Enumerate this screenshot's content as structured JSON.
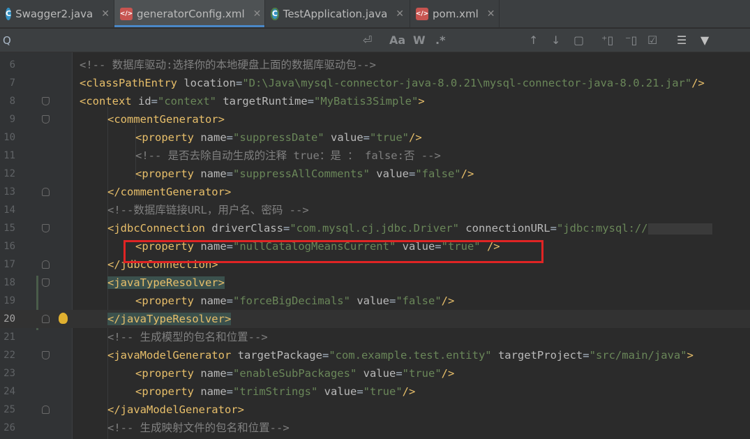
{
  "tabs": [
    {
      "label": "Swagger2.java",
      "icon": "java-class-icon",
      "active": false
    },
    {
      "label": "generatorConfig.xml",
      "icon": "xml-file-icon",
      "active": true
    },
    {
      "label": "TestApplication.java",
      "icon": "spring-app-icon",
      "active": false
    },
    {
      "label": "pom.xml",
      "icon": "xml-file-icon",
      "active": false
    }
  ],
  "tab_close_glyph": "✕",
  "toolbar": {
    "search_glyph": "Q",
    "regex_wrap_glyph": "⏎",
    "match_case": "Aa",
    "words": "W",
    "regex": ".*",
    "prev_glyph": "↑",
    "next_glyph": "↓",
    "select_all_glyph": "▢",
    "add_sel_glyph": "⁺▯",
    "remove_sel_glyph": "⁻▯",
    "toggle_sel_glyph": "☑",
    "filter_glyph": "▼",
    "settings_glyph": "☰"
  },
  "lines": [
    {
      "n": "6",
      "parts": [
        [
          "c",
          "<!-- 数据库驱动:选择你的本地硬盘上面的数据库驱动包-->"
        ]
      ]
    },
    {
      "n": "7",
      "parts": [
        [
          "t",
          "<classPathEntry "
        ],
        [
          "a",
          "location"
        ],
        [
          "p",
          "="
        ],
        [
          "v",
          "\"D:\\Java\\mysql-connector-java-8.0.21\\mysql-connector-java-8.0.21.jar\""
        ],
        [
          "t",
          "/>"
        ]
      ]
    },
    {
      "n": "8",
      "parts": [
        [
          "t",
          "<context "
        ],
        [
          "a",
          "id"
        ],
        [
          "p",
          "="
        ],
        [
          "v",
          "\"context\""
        ],
        [
          "a",
          " targetRuntime"
        ],
        [
          "p",
          "="
        ],
        [
          "v",
          "\"MyBatis3Simple\""
        ],
        [
          "t",
          ">"
        ]
      ]
    },
    {
      "n": "9",
      "parts": [
        [
          "t",
          "<commentGenerator>"
        ]
      ]
    },
    {
      "n": "10",
      "parts": [
        [
          "t",
          "<property "
        ],
        [
          "a",
          "name"
        ],
        [
          "p",
          "="
        ],
        [
          "v",
          "\"suppressDate\""
        ],
        [
          "a",
          " value"
        ],
        [
          "p",
          "="
        ],
        [
          "v",
          "\"true\""
        ],
        [
          "t",
          "/>"
        ]
      ]
    },
    {
      "n": "11",
      "parts": [
        [
          "c",
          "<!-- 是否去除自动生成的注释 true：是 ： false:否 -->"
        ]
      ]
    },
    {
      "n": "12",
      "parts": [
        [
          "t",
          "<property "
        ],
        [
          "a",
          "name"
        ],
        [
          "p",
          "="
        ],
        [
          "v",
          "\"suppressAllComments\""
        ],
        [
          "a",
          " value"
        ],
        [
          "p",
          "="
        ],
        [
          "v",
          "\"false\""
        ],
        [
          "t",
          "/>"
        ]
      ]
    },
    {
      "n": "13",
      "parts": [
        [
          "t",
          "</commentGenerator>"
        ]
      ]
    },
    {
      "n": "14",
      "parts": [
        [
          "c",
          "<!--数据库链接URL，用户名、密码 -->"
        ]
      ]
    },
    {
      "n": "15",
      "parts": [
        [
          "t",
          "<jdbcConnection "
        ],
        [
          "a",
          "driverClass"
        ],
        [
          "p",
          "="
        ],
        [
          "v",
          "\"com.mysql.cj.jdbc.Driver\""
        ],
        [
          "a",
          " connectionURL"
        ],
        [
          "p",
          "="
        ],
        [
          "v",
          "\"jdbc:mysql://"
        ]
      ]
    },
    {
      "n": "16",
      "parts": [
        [
          "t",
          "<property "
        ],
        [
          "a",
          "name"
        ],
        [
          "p",
          "="
        ],
        [
          "v",
          "\"nullCatalogMeansCurrent\""
        ],
        [
          "a",
          " value"
        ],
        [
          "p",
          "="
        ],
        [
          "v",
          "\"true\""
        ],
        [
          "t",
          " />"
        ]
      ]
    },
    {
      "n": "17",
      "parts": [
        [
          "t",
          "</jdbcConnection>"
        ]
      ]
    },
    {
      "n": "18",
      "parts": [
        [
          "t",
          "<javaTypeResolver>"
        ]
      ]
    },
    {
      "n": "19",
      "parts": [
        [
          "t",
          "<property "
        ],
        [
          "a",
          "name"
        ],
        [
          "p",
          "="
        ],
        [
          "v",
          "\"forceBigDecimals\""
        ],
        [
          "a",
          " value"
        ],
        [
          "p",
          "="
        ],
        [
          "v",
          "\"false\""
        ],
        [
          "t",
          "/>"
        ]
      ]
    },
    {
      "n": "20",
      "parts": [
        [
          "t",
          "</javaTypeResolver>"
        ]
      ]
    },
    {
      "n": "21",
      "parts": [
        [
          "c",
          "<!-- 生成模型的包名和位置-->"
        ]
      ]
    },
    {
      "n": "22",
      "parts": [
        [
          "t",
          "<javaModelGenerator "
        ],
        [
          "a",
          "targetPackage"
        ],
        [
          "p",
          "="
        ],
        [
          "v",
          "\"com.example.test.entity\""
        ],
        [
          "a",
          " targetProject"
        ],
        [
          "p",
          "="
        ],
        [
          "v",
          "\"src/main/java\""
        ],
        [
          "t",
          ">"
        ]
      ]
    },
    {
      "n": "23",
      "parts": [
        [
          "t",
          "<property "
        ],
        [
          "a",
          "name"
        ],
        [
          "p",
          "="
        ],
        [
          "v",
          "\"enableSubPackages\""
        ],
        [
          "a",
          " value"
        ],
        [
          "p",
          "="
        ],
        [
          "v",
          "\"true\""
        ],
        [
          "t",
          "/>"
        ]
      ]
    },
    {
      "n": "24",
      "parts": [
        [
          "t",
          "<property "
        ],
        [
          "a",
          "name"
        ],
        [
          "p",
          "="
        ],
        [
          "v",
          "\"trimStrings\""
        ],
        [
          "a",
          " value"
        ],
        [
          "p",
          "="
        ],
        [
          "v",
          "\"true\""
        ],
        [
          "t",
          "/>"
        ]
      ]
    },
    {
      "n": "25",
      "parts": [
        [
          "t",
          "</javaModelGenerator>"
        ]
      ]
    },
    {
      "n": "26",
      "parts": [
        [
          "c",
          "<!-- 生成映射文件的包名和位置-->"
        ]
      ]
    }
  ],
  "colors": {
    "tag": "#e8bf6a",
    "attribute": "#bababa",
    "value": "#6a8759",
    "comment": "#808080",
    "highlight_box": "#e02424",
    "active_tab_underline": "#4a88c7"
  }
}
